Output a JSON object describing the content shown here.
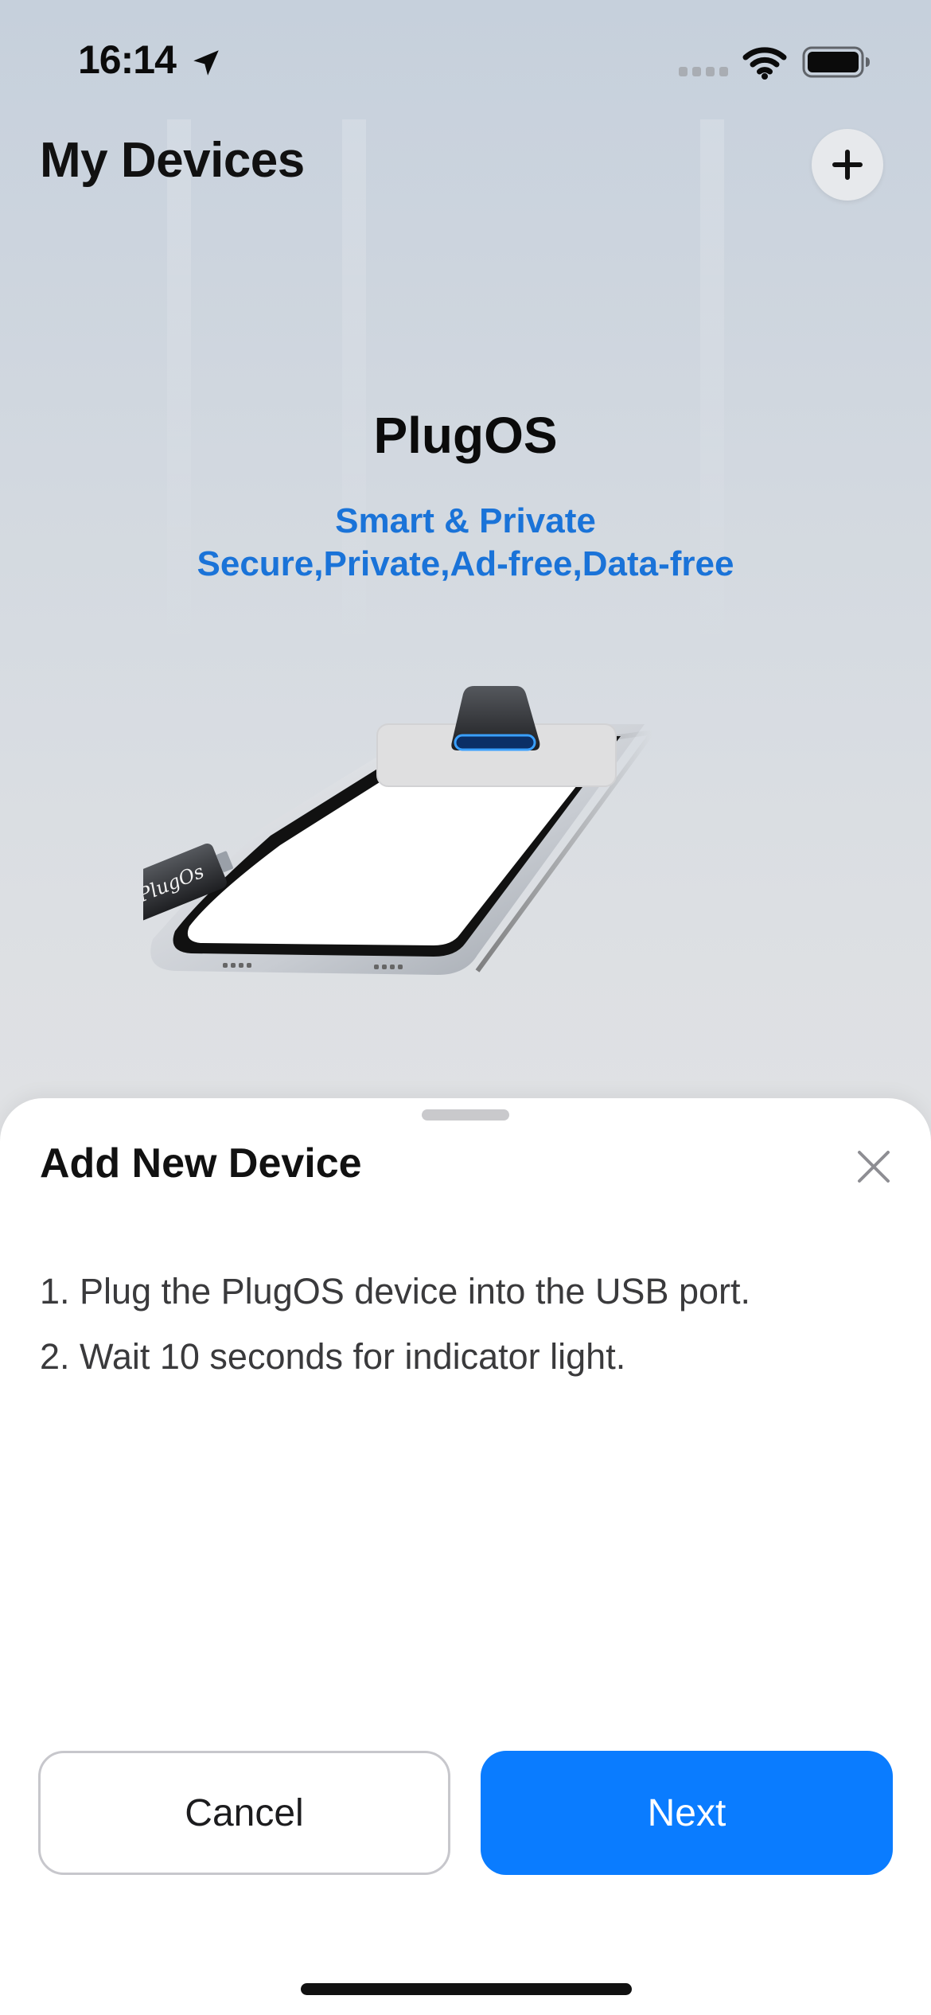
{
  "status_bar": {
    "time": "16:14",
    "icons": [
      "location-arrow-icon",
      "cellular-signal-icon",
      "wifi-icon",
      "battery-icon"
    ]
  },
  "header": {
    "title": "My Devices",
    "add_button_icon": "plus-icon"
  },
  "hero": {
    "product_name": "PlugOS",
    "tagline_line1": "Smart & Private",
    "tagline_line2": "Secure,Private,Ad-free,Data-free",
    "usb_label": "PlugOs"
  },
  "sheet": {
    "title": "Add New Device",
    "close_icon": "close-icon",
    "instructions": [
      "1. Plug the PlugOS device into the USB port.",
      "2. Wait 10 seconds for indicator light."
    ],
    "cancel_label": "Cancel",
    "next_label": "Next"
  },
  "colors": {
    "accent": "#0a7cff",
    "tagline": "#1a73d8",
    "usb_glow": "#3aa0ff"
  }
}
